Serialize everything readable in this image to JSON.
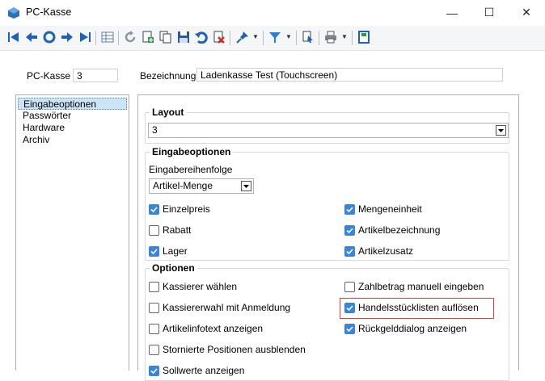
{
  "window": {
    "title": "PC-Kasse",
    "minimize": "—",
    "maximize": "☐",
    "close": "✕"
  },
  "header": {
    "pckasse_label": "PC-Kasse",
    "pckasse_value": "3",
    "bezeichnung_label": "Bezeichnung",
    "bezeichnung_value": "Ladenkasse Test (Touchscreen)"
  },
  "nav": {
    "items": [
      "Eingabeoptionen",
      "Passwörter",
      "Hardware",
      "Archiv"
    ],
    "selected": "Eingabeoptionen"
  },
  "layout_group": {
    "title": "Layout",
    "value": "3"
  },
  "eingabe_group": {
    "title": "Eingabeoptionen",
    "order_label": "Eingabereihenfolge",
    "order_value": "Artikel-Menge",
    "checkboxes": [
      {
        "label": "Einzelpreis",
        "checked": true
      },
      {
        "label": "Mengeneinheit",
        "checked": true
      },
      {
        "label": "Rabatt",
        "checked": false
      },
      {
        "label": "Artikelbezeichnung",
        "checked": true
      },
      {
        "label": "Lager",
        "checked": true
      },
      {
        "label": "Artikelzusatz",
        "checked": true
      }
    ]
  },
  "optionen_group": {
    "title": "Optionen",
    "checkboxes": [
      {
        "label": "Kassierer wählen",
        "checked": false
      },
      {
        "label": "Zahlbetrag manuell eingeben",
        "checked": false
      },
      {
        "label": "Kassiererwahl mit Anmeldung",
        "checked": false
      },
      {
        "label": "Handelsstücklisten auflösen",
        "checked": true
      },
      {
        "label": "Artikelinfotext anzeigen",
        "checked": false
      },
      {
        "label": "Rückgelddialog anzeigen",
        "checked": true
      },
      {
        "label": "Stornierte Positionen ausblenden",
        "checked": false
      },
      {
        "label": "Sollwerte anzeigen",
        "checked": true
      }
    ]
  },
  "colors": {
    "accent": "#3b84d7",
    "highlight": "#e0413a",
    "selection": "#cce4f7"
  }
}
